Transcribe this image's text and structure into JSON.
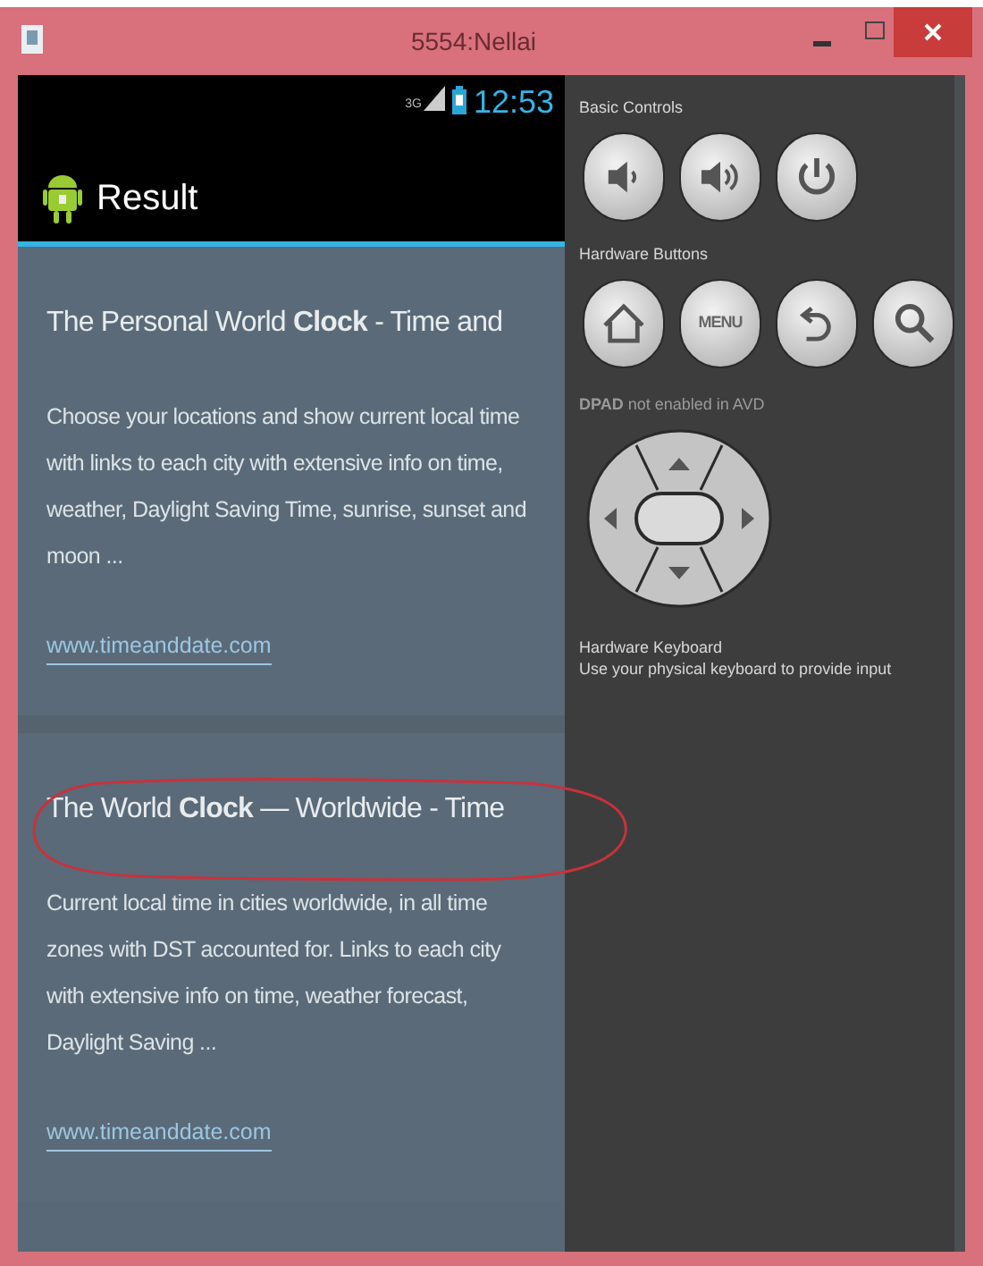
{
  "window": {
    "title": "5554:Nellai"
  },
  "status_bar": {
    "network": "3G",
    "time": "12:53"
  },
  "action_bar": {
    "title": "Result"
  },
  "results": [
    {
      "title": "The Personal World **Clock** - Time and",
      "snippet": "Choose your locations and show current local time with links to each city with extensive info on time, weather, Daylight Saving Time, sunrise, sunset and moon ...",
      "url": "www.timeanddate.com"
    },
    {
      "title": "The World **Clock** — Worldwide - Time",
      "snippet": "Current local time in cities worldwide, in all time zones with DST accounted for. Links to each city with extensive info on time, weather forecast, Daylight Saving ...",
      "url": "www.timeanddate.com"
    }
  ],
  "controls_panel": {
    "sections": [
      {
        "kind": "buttons",
        "heading": "Basic Controls",
        "buttons": [
          {
            "kind": "volume-down"
          },
          {
            "kind": "volume-up"
          },
          {
            "kind": "power"
          }
        ]
      },
      {
        "kind": "buttons",
        "heading": "Hardware Buttons",
        "buttons": [
          {
            "kind": "home"
          },
          {
            "kind": "menu",
            "label": "MENU"
          },
          {
            "kind": "back"
          },
          {
            "kind": "search"
          }
        ]
      },
      {
        "kind": "dpad",
        "heading": "**DPAD** not enabled in AVD"
      },
      {
        "kind": "note",
        "heading": "Hardware Keyboard",
        "note": "Use your physical keyboard to provide input"
      }
    ]
  }
}
